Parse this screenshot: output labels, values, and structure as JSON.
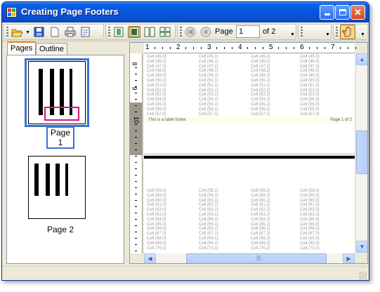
{
  "window": {
    "title": "Creating Page Footers"
  },
  "toolbar": {
    "page_label": "Page",
    "page_value": "1",
    "page_of": "of 2",
    "buttons": [
      "open-icon",
      "save-icon",
      "new-icon",
      "print-icon",
      "page-setup-icon",
      "single-page-icon",
      "two-page-icon",
      "multi-page-icon",
      "first-page-icon",
      "previous-page-icon",
      "hand-tool-icon"
    ]
  },
  "left_pane": {
    "tabs": [
      "Pages",
      "Outline"
    ],
    "thumbnails": [
      {
        "caption": "Page 1",
        "selected": true
      },
      {
        "caption": "Page 2",
        "selected": false
      }
    ]
  },
  "ruler": {
    "h_numbers": [
      "1",
      "2",
      "3",
      "4",
      "5",
      "6",
      "7"
    ],
    "v_numbers": [
      "8",
      "9",
      "10"
    ]
  },
  "page1_rows": [
    [
      "Cell (45,0)",
      "Cell (45,1)",
      "Cell (45,2)",
      "Cell (45,3)"
    ],
    [
      "Cell (46,0)",
      "Cell (46,1)",
      "Cell (46,2)",
      "Cell (46,3)"
    ],
    [
      "Cell (47,0)",
      "Cell (47,1)",
      "Cell (47,2)",
      "Cell (47,3)"
    ],
    [
      "Cell (48,0)",
      "Cell (48,1)",
      "Cell (48,2)",
      "Cell (48,3)"
    ],
    [
      "Cell (49,0)",
      "Cell (49,1)",
      "Cell (49,2)",
      "Cell (49,3)"
    ],
    [
      "Cell (50,0)",
      "Cell (50,1)",
      "Cell (50,2)",
      "Cell (50,3)"
    ],
    [
      "Cell (51,0)",
      "Cell (51,1)",
      "Cell (51,2)",
      "Cell (51,3)"
    ],
    [
      "Cell (52,0)",
      "Cell (52,1)",
      "Cell (52,2)",
      "Cell (52,3)"
    ],
    [
      "Cell (53,0)",
      "Cell (53,1)",
      "Cell (53,2)",
      "Cell (53,3)"
    ],
    [
      "Cell (54,0)",
      "Cell (54,1)",
      "Cell (54,2)",
      "Cell (54,3)"
    ],
    [
      "Cell (55,0)",
      "Cell (55,1)",
      "Cell (55,2)",
      "Cell (55,3)"
    ],
    [
      "Cell (56,0)",
      "Cell (56,1)",
      "Cell (56,2)",
      "Cell (56,3)"
    ],
    [
      "Cell (57,0)",
      "Cell (57,1)",
      "Cell (57,2)",
      "Cell (57,3)"
    ]
  ],
  "footer": {
    "left": "This is a table footer.",
    "right": "Page 1 of 2"
  },
  "page2_rows": [
    [
      "Cell (58,0)",
      "Cell (58,1)",
      "Cell (58,2)",
      "Cell (58,3)"
    ],
    [
      "Cell (59,0)",
      "Cell (59,1)",
      "Cell (59,2)",
      "Cell (59,3)"
    ],
    [
      "Cell (60,0)",
      "Cell (60,1)",
      "Cell (60,2)",
      "Cell (60,3)"
    ],
    [
      "Cell (61,0)",
      "Cell (61,1)",
      "Cell (61,2)",
      "Cell (61,3)"
    ],
    [
      "Cell (62,0)",
      "Cell (62,1)",
      "Cell (62,2)",
      "Cell (62,3)"
    ],
    [
      "Cell (63,0)",
      "Cell (63,1)",
      "Cell (63,2)",
      "Cell (63,3)"
    ],
    [
      "Cell (64,0)",
      "Cell (64,1)",
      "Cell (64,2)",
      "Cell (64,3)"
    ],
    [
      "Cell (65,0)",
      "Cell (65,1)",
      "Cell (65,2)",
      "Cell (65,3)"
    ],
    [
      "Cell (66,0)",
      "Cell (66,1)",
      "Cell (66,2)",
      "Cell (66,3)"
    ],
    [
      "Cell (67,0)",
      "Cell (67,1)",
      "Cell (67,2)",
      "Cell (67,3)"
    ],
    [
      "Cell (68,0)",
      "Cell (68,1)",
      "Cell (68,2)",
      "Cell (68,3)"
    ],
    [
      "Cell (69,0)",
      "Cell (69,1)",
      "Cell (69,2)",
      "Cell (69,3)"
    ],
    [
      "Cell (70,0)",
      "Cell (70,1)",
      "Cell (70,2)",
      "Cell (70,3)"
    ]
  ],
  "colors": {
    "titlebar": "#0655de",
    "selection": "#3b72cf",
    "pressed_button": "#f8d58a"
  }
}
